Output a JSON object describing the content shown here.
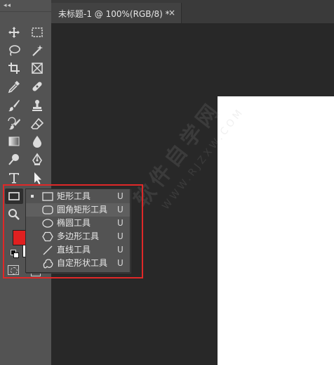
{
  "document_tab": {
    "title": "未标题-1 @ 100%(RGB/8) *",
    "close_glyph": "×"
  },
  "toolbar": {
    "grip_glyph": "◂◂",
    "tools": [
      {
        "icon": "move-icon"
      },
      {
        "icon": "rectangular-marquee-icon"
      },
      {
        "icon": "lasso-icon"
      },
      {
        "icon": "magic-wand-icon"
      },
      {
        "icon": "crop-icon"
      },
      {
        "icon": "frame-icon"
      },
      {
        "icon": "eyedropper-icon"
      },
      {
        "icon": "healing-brush-icon"
      },
      {
        "icon": "brush-icon"
      },
      {
        "icon": "clone-stamp-icon"
      },
      {
        "icon": "history-brush-icon"
      },
      {
        "icon": "eraser-icon"
      },
      {
        "icon": "gradient-icon"
      },
      {
        "icon": "blur-icon"
      },
      {
        "icon": "dodge-icon"
      },
      {
        "icon": "pen-icon"
      },
      {
        "icon": "type-icon"
      },
      {
        "icon": "path-selection-icon"
      },
      {
        "icon": "rectangle-tool-icon"
      },
      {
        "icon": "zoom-icon"
      }
    ],
    "foreground_color": "#e02020",
    "background_color": "#ffffff"
  },
  "shape_flyout": {
    "items": [
      {
        "label": "矩形工具",
        "shortcut": "U",
        "icon": "rectangle-shape-icon",
        "active": true
      },
      {
        "label": "圆角矩形工具",
        "shortcut": "U",
        "icon": "rounded-rectangle-icon",
        "hover": true
      },
      {
        "label": "椭圆工具",
        "shortcut": "U",
        "icon": "ellipse-icon"
      },
      {
        "label": "多边形工具",
        "shortcut": "U",
        "icon": "polygon-icon"
      },
      {
        "label": "直线工具",
        "shortcut": "U",
        "icon": "line-icon"
      },
      {
        "label": "自定形状工具",
        "shortcut": "U",
        "icon": "custom-shape-icon"
      }
    ]
  },
  "watermark": {
    "big": "软件自学网",
    "small": "WWW.RJZXW.COM"
  },
  "colors": {
    "accent_highlight": "#e02828",
    "canvas": "#282828",
    "panel": "#535353"
  }
}
